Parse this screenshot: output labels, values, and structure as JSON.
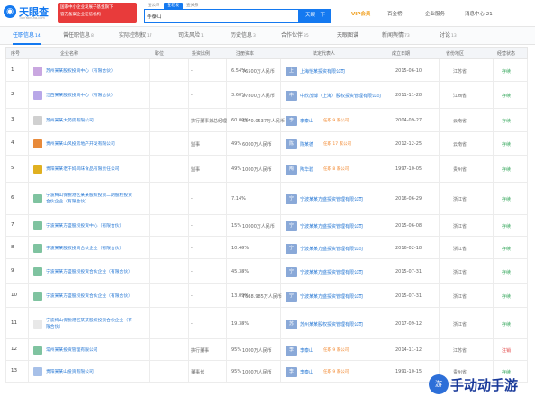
{
  "header": {
    "logo_text": "天眼查",
    "logo_sub": "TianYanCha.com",
    "promo_lines": [
      "国家中小企业发展子基金旗下",
      "官方备案企业征信机构"
    ],
    "search_tabs": [
      "查公司",
      "查老板",
      "查关系"
    ],
    "search_value": "李泰山",
    "search_button": "天眼一下",
    "nav": {
      "vip": "VIP会员",
      "app": "百金榜",
      "enterprise": "企业服务",
      "messages": "消息中心 21"
    }
  },
  "tabs": [
    {
      "label": "任职信息",
      "count": "14"
    },
    {
      "label": "曾任职信息",
      "count": "8"
    },
    {
      "label": "实际控制权",
      "count": "17"
    },
    {
      "label": "司法风险",
      "count": "1"
    },
    {
      "label": "历史信息",
      "count": "3"
    },
    {
      "label": "合作伙伴",
      "count": "35"
    },
    {
      "label": "天眼图谱",
      "count": ""
    },
    {
      "label": "新闻舆情",
      "count": "73"
    },
    {
      "label": "讨论",
      "count": "13"
    }
  ],
  "table": {
    "headers": [
      "序号",
      "企业名称",
      "职位",
      "投资比例",
      "注册资本",
      "法定代表人",
      "成立日期",
      "省份地区",
      "经营状态"
    ],
    "rows": [
      {
        "idx": "1",
        "name": "苏州某某股权投资中心（有限合伙）",
        "position": "-",
        "ratio": "6.54%",
        "capital": "76500万人民币",
        "legal": "上海怡某投资有限公司",
        "legal_avatar": "上",
        "legal_tag": "",
        "date": "2015-06-10",
        "region": "江苏省",
        "status": "存续",
        "logo_color": "#c9a7e0"
      },
      {
        "idx": "2",
        "name": "江西某某股权投资中心（有限合伙）",
        "position": "-",
        "ratio": "3.60%",
        "capital": "27800万人民币",
        "legal": "中欣茂博（上海）股权投资管理有限公司",
        "legal_avatar": "中",
        "legal_tag": "",
        "date": "2011-11-28",
        "region": "江西省",
        "status": "存续",
        "logo_color": "#b8a7e8"
      },
      {
        "idx": "3",
        "name": "苏州某某大药房有限公司",
        "position": "执行董事兼总经理",
        "ratio": "60.00%",
        "capital": "6570.0537万人民币",
        "legal": "李泰山",
        "legal_avatar": "李",
        "legal_tag": "任职 9 家公司",
        "date": "2004-09-27",
        "region": "云南省",
        "status": "存续",
        "logo_color": "#d0d0d0"
      },
      {
        "idx": "4",
        "name": "贵州某某山风投房地产开发有限公司",
        "position": "监事",
        "ratio": "49%",
        "capital": "6000万人民币",
        "legal": "陈某德",
        "legal_avatar": "陈",
        "legal_tag": "任职 17 家公司",
        "date": "2012-12-25",
        "region": "云南省",
        "status": "存续",
        "logo_color": "#e88a3a"
      },
      {
        "idx": "5",
        "name": "贵阳某某老干妈风味食品有限责任公司",
        "position": "监事",
        "ratio": "49%",
        "capital": "1000万人民币",
        "legal": "陶华碧",
        "legal_avatar": "陶",
        "legal_tag": "任职 8 家公司",
        "date": "1997-10-05",
        "region": "贵州省",
        "status": "存续",
        "logo_color": "#e0b020"
      },
      {
        "idx": "6",
        "name": "宁波梅山保税港区某某股权投资二期股权投资合伙企业（有限合伙）",
        "position": "-",
        "ratio": "7.14%",
        "capital": "-",
        "legal": "宁波某某方盛投资管理有限公司",
        "legal_avatar": "宁",
        "legal_tag": "",
        "date": "2016-06-29",
        "region": "浙江省",
        "status": "存续",
        "logo_color": "#7fc3a0"
      },
      {
        "idx": "7",
        "name": "宁波某某方盛股权投资中心（有限合伙）",
        "position": "-",
        "ratio": "15%",
        "capital": "10000万人民币",
        "legal": "宁波某某方盛投资管理有限公司",
        "legal_avatar": "宁",
        "legal_tag": "",
        "date": "2015-06-08",
        "region": "浙江省",
        "status": "存续",
        "logo_color": "#7fc3a0"
      },
      {
        "idx": "8",
        "name": "宁波某某股权投资合伙企业（有限合伙）",
        "position": "-",
        "ratio": "10.40%",
        "capital": "-",
        "legal": "宁波某某方盛投资管理有限公司",
        "legal_avatar": "宁",
        "legal_tag": "",
        "date": "2016-02-18",
        "region": "浙江省",
        "status": "存续",
        "logo_color": "#7fc3a0"
      },
      {
        "idx": "9",
        "name": "宁波某某方盛股权投资合伙企业（有限合伙）",
        "position": "-",
        "ratio": "45.38%",
        "capital": "-",
        "legal": "宁波某某方盛投资管理有限公司",
        "legal_avatar": "宁",
        "legal_tag": "",
        "date": "2015-07-31",
        "region": "浙江省",
        "status": "存续",
        "logo_color": "#7fc3a0"
      },
      {
        "idx": "10",
        "name": "宁波某某方盛股权投资合伙企业（有限合伙）",
        "position": "-",
        "ratio": "13.09%",
        "capital": "7638.985万人民币",
        "legal": "宁波某某方盛投资管理有限公司",
        "legal_avatar": "宁",
        "legal_tag": "",
        "date": "2015-07-31",
        "region": "浙江省",
        "status": "存续",
        "logo_color": "#7fc3a0"
      },
      {
        "idx": "11",
        "name": "宁波梅山保税港区某某股权投资合伙企业（有限合伙）",
        "position": "-",
        "ratio": "19.38%",
        "capital": "-",
        "legal": "苏州某某股权投资管理有限公司",
        "legal_avatar": "苏",
        "legal_tag": "",
        "date": "2017-09-12",
        "region": "浙江省",
        "status": "存续",
        "logo_color": "#e8e8e8"
      },
      {
        "idx": "12",
        "name": "常州某某投资管理有限公司",
        "position": "执行董事",
        "ratio": "95%",
        "capital": "1000万人民币",
        "legal": "李泰山",
        "legal_avatar": "李",
        "legal_tag": "任职 9 家公司",
        "date": "2014-11-12",
        "region": "江苏省",
        "status": "注销",
        "logo_color": "#7fc3a0"
      },
      {
        "idx": "13",
        "name": "贵阳某某山投资有限公司",
        "position": "董事长",
        "ratio": "95%",
        "capital": "1000万人民币",
        "legal": "李泰山",
        "legal_avatar": "李",
        "legal_tag": "任职 9 家公司",
        "date": "1991-10-15",
        "region": "贵州省",
        "status": "存续",
        "logo_color": "#a7c0e8"
      }
    ]
  },
  "watermark": {
    "text": "手动动手游",
    "mark": "游"
  },
  "colors": {
    "brand": "#1479f0",
    "link": "#2a7ad5",
    "ok": "#33a65a",
    "bad": "#e24b4b",
    "tag": "#f28a33"
  }
}
